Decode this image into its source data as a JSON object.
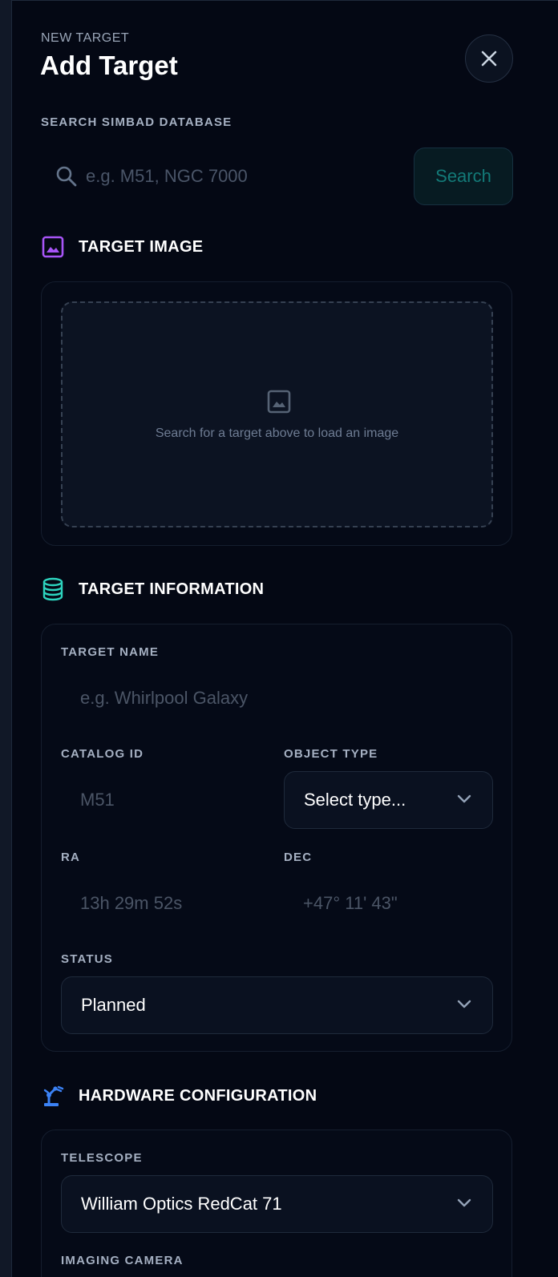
{
  "header": {
    "eyebrow": "NEW TARGET",
    "title": "Add Target"
  },
  "search": {
    "label": "SEARCH SIMBAD DATABASE",
    "placeholder": "e.g. M51, NGC 7000",
    "button_label": "Search"
  },
  "target_image": {
    "heading": "TARGET IMAGE",
    "hint": "Search for a target above to load an image"
  },
  "target_info": {
    "heading": "TARGET INFORMATION",
    "name_label": "TARGET NAME",
    "name_placeholder": "e.g. Whirlpool Galaxy",
    "catalog_label": "CATALOG ID",
    "catalog_placeholder": "M51",
    "object_type_label": "OBJECT TYPE",
    "object_type_value": "Select type...",
    "ra_label": "RA",
    "ra_placeholder": "13h 29m 52s",
    "dec_label": "DEC",
    "dec_placeholder": "+47° 11' 43\"",
    "status_label": "STATUS",
    "status_value": "Planned"
  },
  "hardware": {
    "heading": "HARDWARE CONFIGURATION",
    "telescope_label": "TELESCOPE",
    "telescope_value": "William Optics RedCat 71",
    "camera_label": "IMAGING CAMERA"
  },
  "icons": {
    "close": "close-icon",
    "search": "search-icon",
    "image": "image-icon",
    "database": "database-icon",
    "hardware": "telescope-icon",
    "chevron": "chevron-down-icon"
  },
  "colors": {
    "image_icon": "#a855f7",
    "database_icon": "#2dd4bf",
    "hardware_icon": "#3b82f6",
    "search_button_text": "#137a78"
  }
}
